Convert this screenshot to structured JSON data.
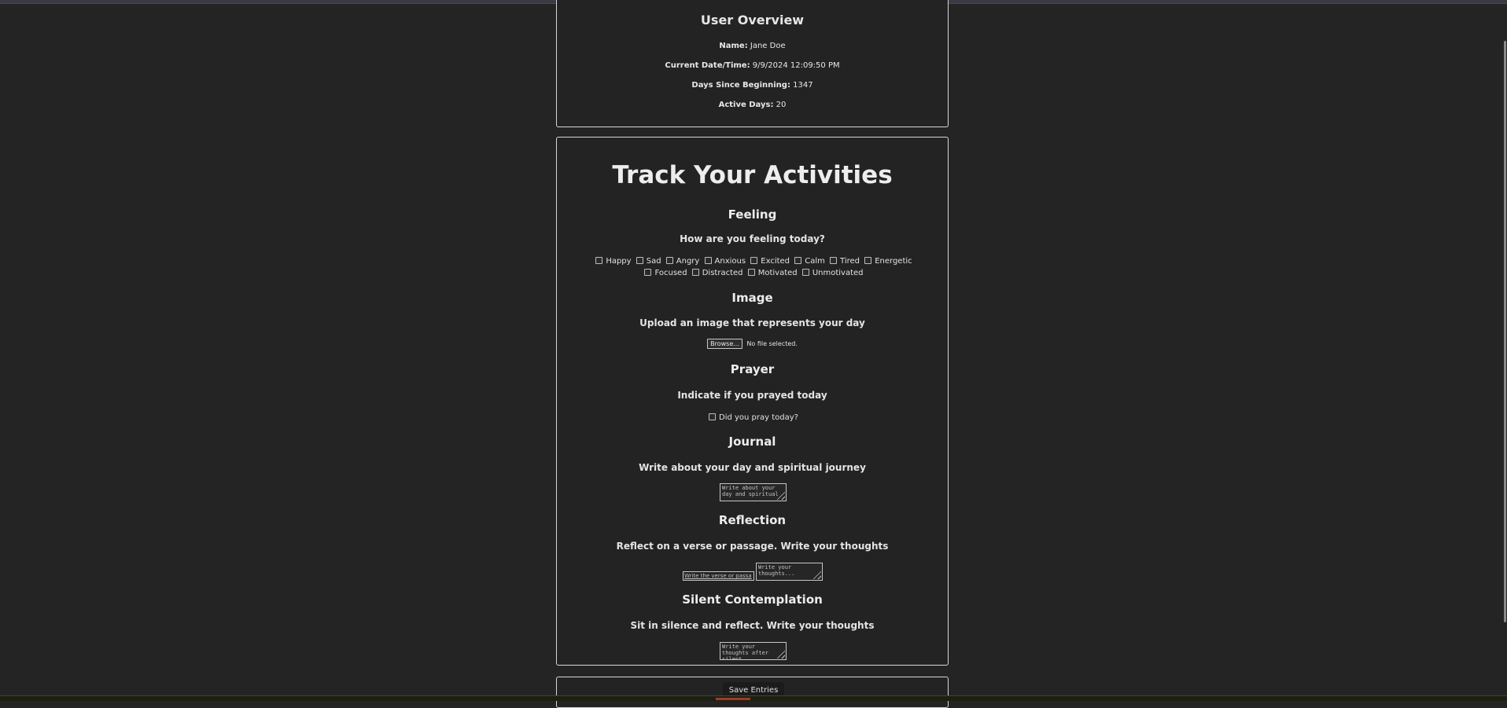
{
  "overview": {
    "title": "User Overview",
    "name_label": "Name:",
    "name_value": "Jane Doe",
    "datetime_label": "Current Date/Time:",
    "datetime_value": "9/9/2024 12:09:50 PM",
    "days_label": "Days Since Beginning:",
    "days_value": "1347",
    "active_label": "Active Days:",
    "active_value": "20"
  },
  "tracker": {
    "title": "Track Your Activities",
    "feeling": {
      "title": "Feeling",
      "subtitle": "How are you feeling today?",
      "options": [
        "Happy",
        "Sad",
        "Angry",
        "Anxious",
        "Excited",
        "Calm",
        "Tired",
        "Energetic",
        "Focused",
        "Distracted",
        "Motivated",
        "Unmotivated"
      ]
    },
    "image": {
      "title": "Image",
      "subtitle": "Upload an image that represents your day",
      "browse_label": "Browse...",
      "file_status": "No file selected."
    },
    "prayer": {
      "title": "Prayer",
      "subtitle": "Indicate if you prayed today",
      "checkbox_label": "Did you pray today?"
    },
    "journal": {
      "title": "Journal",
      "subtitle": "Write about your day and spiritual journey",
      "placeholder": "Write about your day and spiritual"
    },
    "reflection": {
      "title": "Reflection",
      "subtitle": "Reflect on a verse or passage. Write your thoughts",
      "verse_placeholder": "Write the verse or passa",
      "thoughts_placeholder": "Write your thoughts..."
    },
    "contemplation": {
      "title": "Silent Contemplation",
      "subtitle": "Sit in silence and reflect. Write your thoughts",
      "placeholder": "Write your thoughts after silent"
    }
  },
  "save": {
    "label": "Save Entries"
  }
}
